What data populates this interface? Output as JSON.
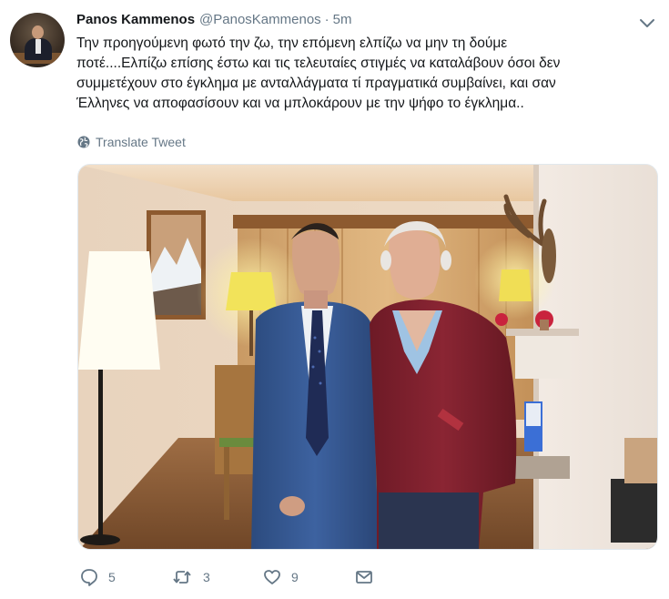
{
  "tweet": {
    "author": {
      "name": "Panos Kammenos",
      "handle": "@PanosKammenos"
    },
    "separator": "·",
    "time": "5m",
    "text_lines": [
      "Την προηγούμενη φωτό την ζω, την επόμενη ελπίζω να μην τη δούμε",
      "ποτέ....Ελπίζω επίσης έστω και τις τελευταίες στιγμές να καταλάβουν όσοι δεν",
      "συμμετέχουν στο έγκλημα με ανταλλάγματα τί πραγματικά συμβαίνει, και σαν",
      "Έλληνες να αποφασίσουν και να μπλοκάρουν με την ψήφο το έγκλημα.."
    ],
    "translate_label": "Translate Tweet",
    "actions": {
      "reply_count": "5",
      "retweet_count": "3",
      "like_count": "9"
    }
  },
  "icons": {
    "menu": "chevron-down-icon",
    "translate": "globe-icon",
    "reply": "speech-bubble-icon",
    "retweet": "retweet-arrows-icon",
    "like": "heart-icon",
    "dm": "envelope-icon"
  },
  "colors": {
    "text_primary": "#14171a",
    "text_secondary": "#657786",
    "border": "#e1e8ed"
  }
}
